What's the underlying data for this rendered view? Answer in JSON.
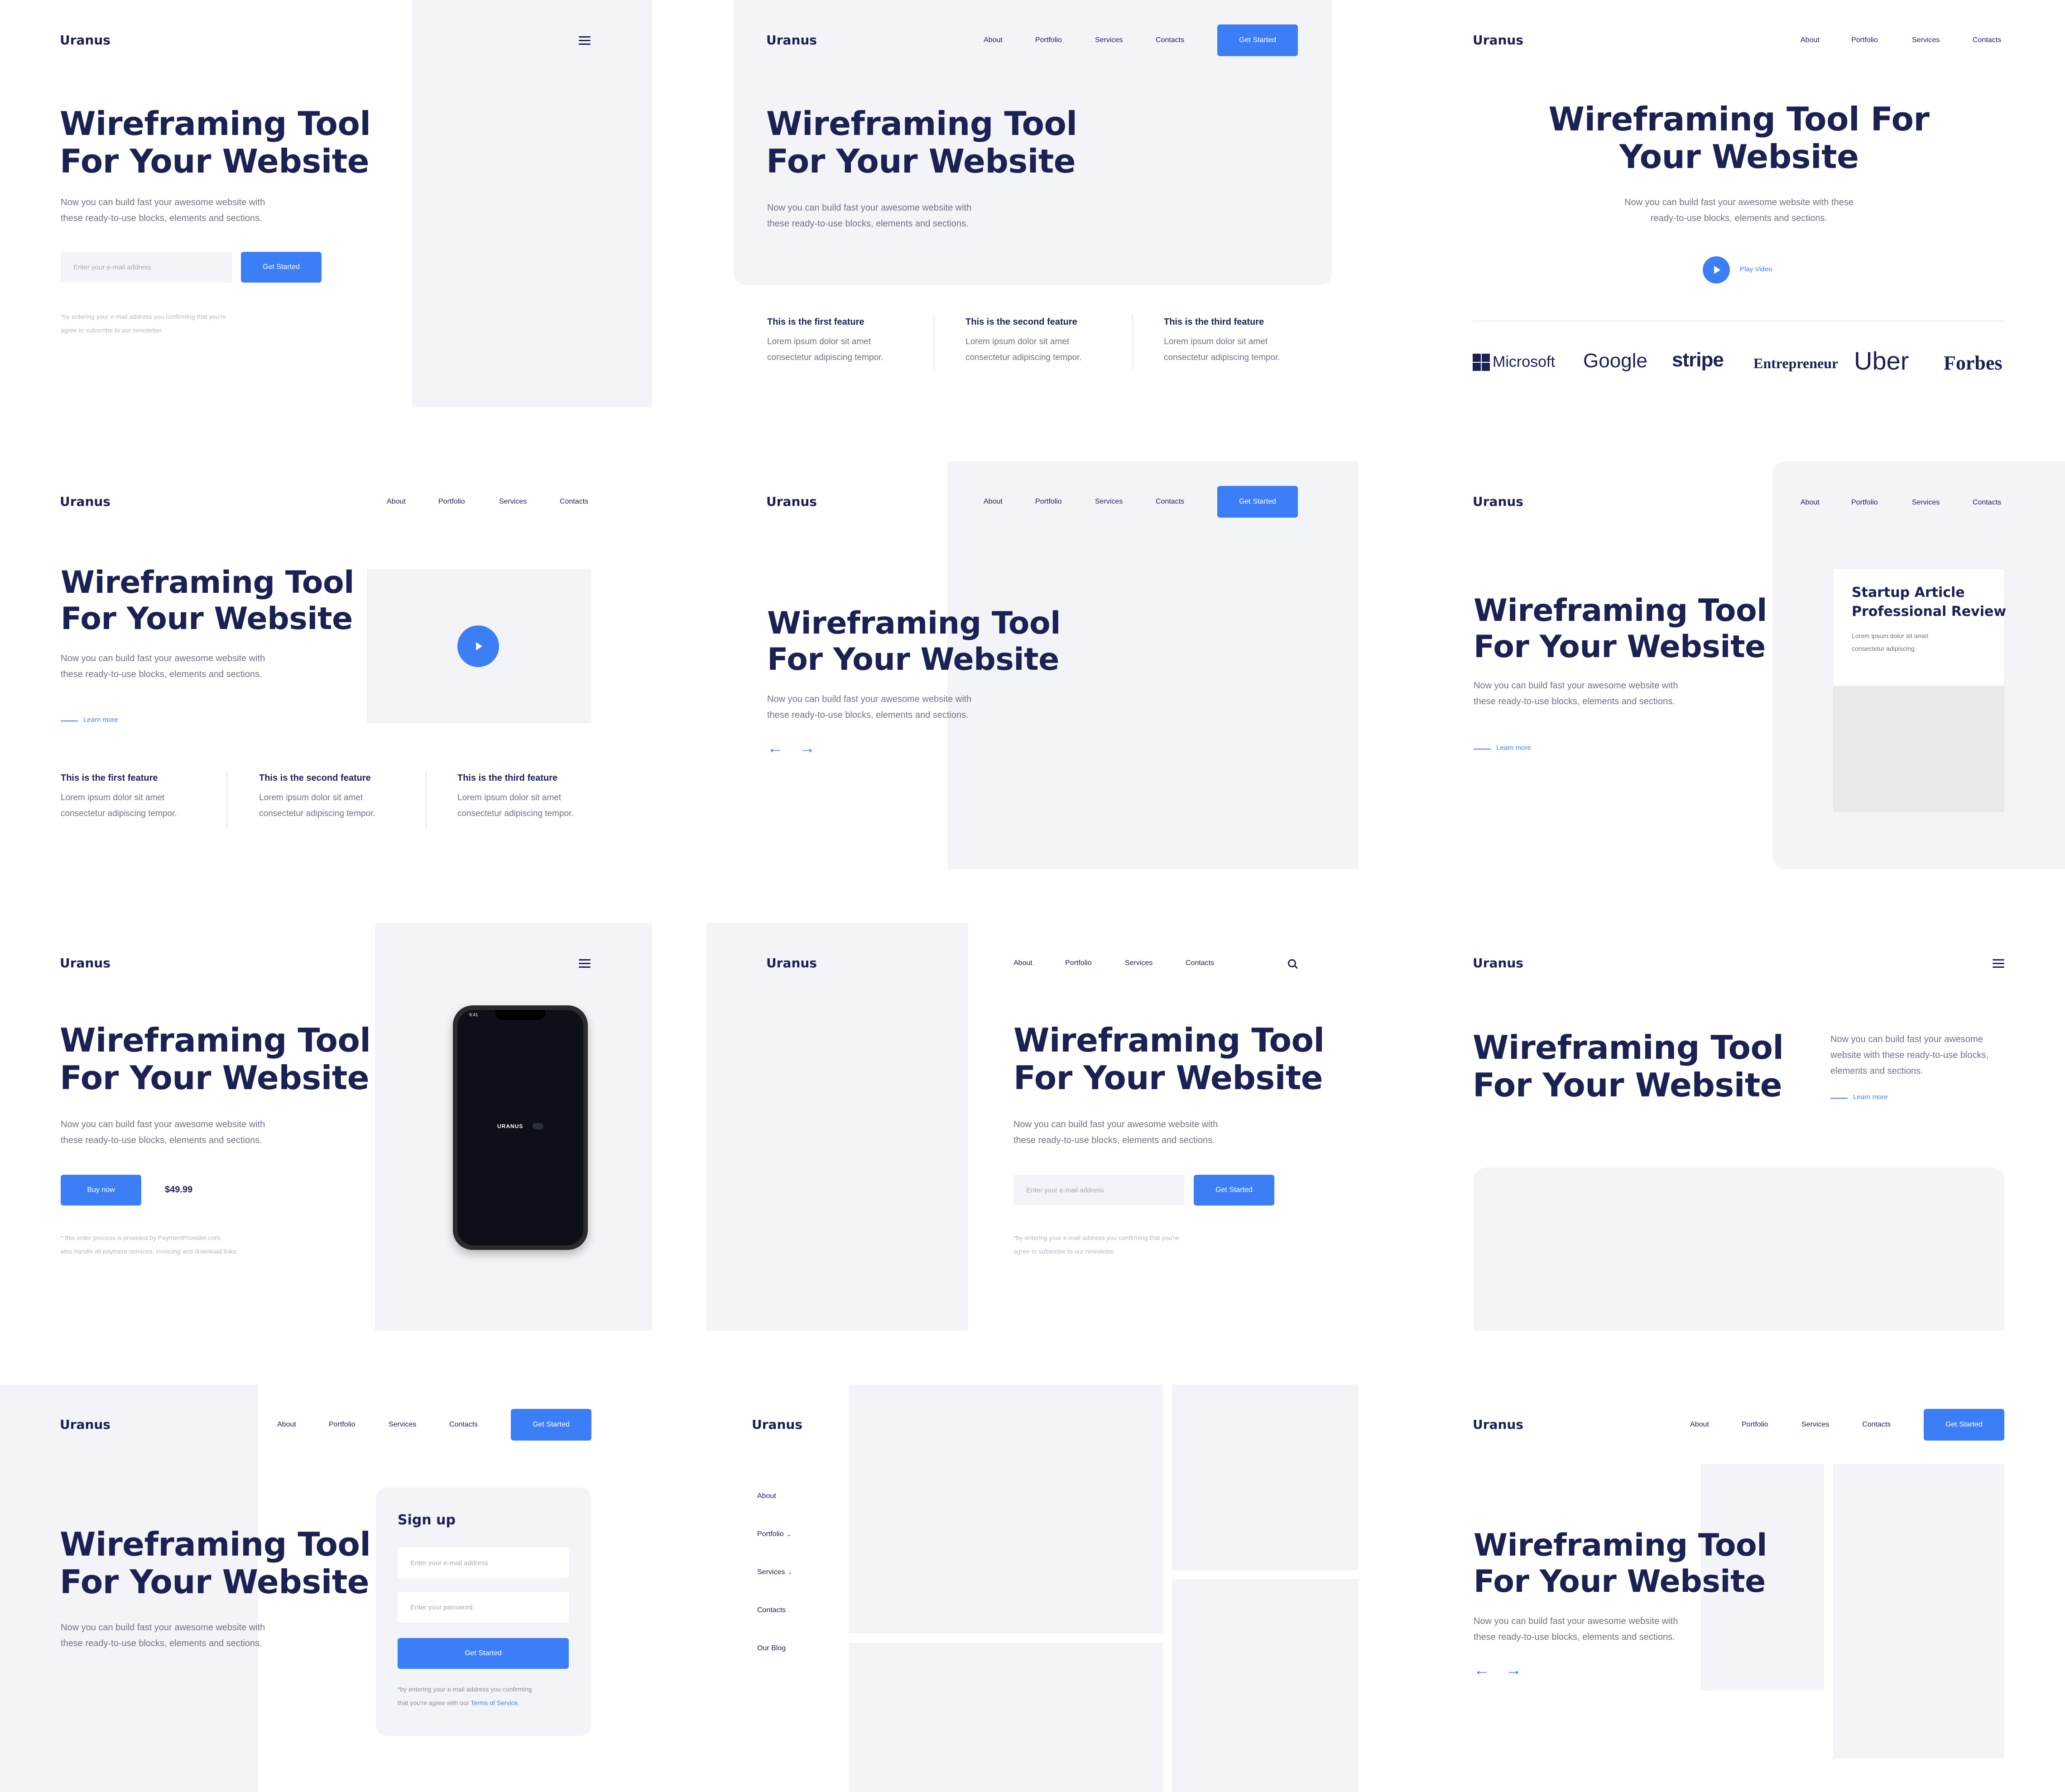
{
  "brand": "Uranus",
  "nav": [
    "About",
    "Portfolio",
    "Services",
    "Contacts"
  ],
  "cta": "Get Started",
  "hero_title": [
    "Wireframing Tool",
    "For Your Website"
  ],
  "hero_title_centered": [
    "Wireframing Tool For",
    "Your Website"
  ],
  "hero_sub": [
    "Now you can build fast your awesome website with",
    "these ready-to-use blocks, elements and sections."
  ],
  "hero_sub_centered": [
    "Now you can build fast your awesome website with these",
    "ready-to-use blocks, elements and sections."
  ],
  "hero_sub_narrow": [
    "Now you can build fast your awesome",
    "website with these ready-to-use blocks,",
    "elements and sections."
  ],
  "email_placeholder": "Enter your e-mail address",
  "password_placeholder": "Enter your password",
  "newsletter_note": [
    "*by entering your e-mail address you confirming that you're",
    "agree to subscribe to our newsletter."
  ],
  "features": [
    {
      "title": "This is the first feature",
      "desc": [
        "Lorem ipsum dolor sit amet",
        "consectetur adipiscing tempor."
      ]
    },
    {
      "title": "This is the second feature",
      "desc": [
        "Lorem ipsum dolor sit amet",
        "consectetur adipiscing tempor."
      ]
    },
    {
      "title": "This is the third feature",
      "desc": [
        "Lorem ipsum dolor sit amet",
        "consectetur adipiscing tempor."
      ]
    }
  ],
  "play_video": "Play Video",
  "brands": [
    "Microsoft",
    "Google",
    "stripe",
    "Entrepreneur",
    "Uber",
    "Forbes"
  ],
  "learn_more": "Learn more",
  "article": {
    "title": [
      "Startup Article",
      "Professional Review"
    ],
    "desc": [
      "Lorem ipsum dolor sit amet",
      "consectetur adipiscing."
    ]
  },
  "phone": {
    "time": "9:41",
    "label": "URANUS"
  },
  "buy_now": "Buy now",
  "price": "$49.99",
  "payment_note": [
    "* this order process is provided by PaymentProvider.com,",
    "who handle all payment services, invoicing and download links."
  ],
  "signup": {
    "title": "Sign up",
    "note_line1": "*by entering your e-mail address you confirming",
    "note_line2": "that you're agree with our",
    "terms": "Terms of Service."
  },
  "sidebar_nav": [
    "About",
    "Portfolio",
    "Services",
    "Contacts",
    "Our Blog"
  ],
  "arrows": {
    "prev": "←",
    "next": "→"
  },
  "colors": {
    "accent": "#3c7ef6",
    "ink": "#1b2152",
    "muted": "#6f7285",
    "panel": "#f3f4f8"
  }
}
